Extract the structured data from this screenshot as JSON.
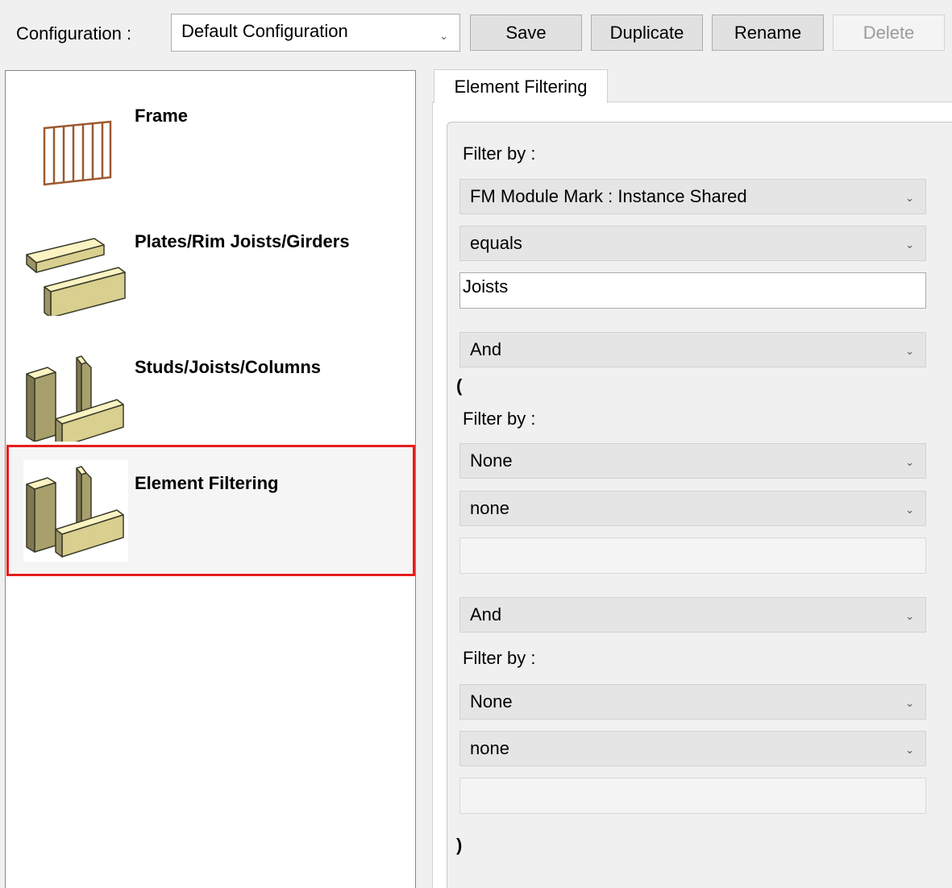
{
  "toolbar": {
    "config_label": "Configuration :",
    "config_value": "Default Configuration",
    "save_label": "Save",
    "duplicate_label": "Duplicate",
    "rename_label": "Rename",
    "delete_label": "Delete"
  },
  "categories": {
    "items": [
      {
        "label": "Frame",
        "icon": "frame-icon"
      },
      {
        "label": "Plates/Rim Joists/Girders",
        "icon": "plates-icon"
      },
      {
        "label": "Studs/Joists/Columns",
        "icon": "studs-icon"
      },
      {
        "label": "Element Filtering",
        "icon": "element-filtering-icon",
        "selected": true
      }
    ],
    "highlight_color": "#e41d1d"
  },
  "tabs": [
    {
      "label": "Element Filtering",
      "active": true
    }
  ],
  "filter": {
    "filter_by_label": "Filter by :",
    "open_paren": "(",
    "close_paren": ")",
    "first": {
      "field": "FM Module Mark : Instance Shared",
      "operator": "equals",
      "value": "Joists"
    },
    "join_1": "And",
    "second": {
      "field": "None",
      "operator": "none",
      "value": ""
    },
    "join_2": "And",
    "third": {
      "field": "None",
      "operator": "none",
      "value": ""
    }
  }
}
